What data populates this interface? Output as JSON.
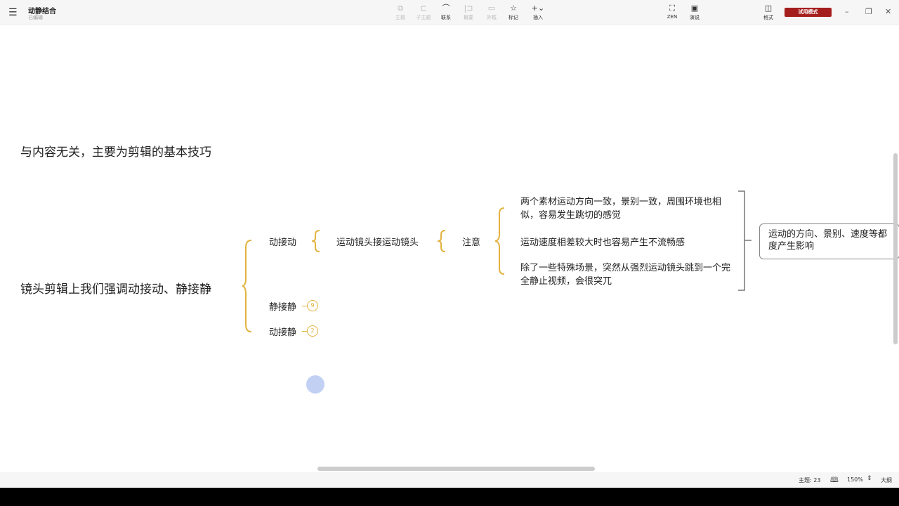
{
  "app": {
    "title": "动静结合",
    "status": "已编辑"
  },
  "toolbar": [
    {
      "label": "主题",
      "icon": "topic-icon",
      "enabled": false
    },
    {
      "label": "子主题",
      "icon": "subtopic-icon",
      "enabled": false
    },
    {
      "label": "联系",
      "icon": "relationship-icon",
      "enabled": true
    },
    {
      "label": "概要",
      "icon": "summary-icon",
      "enabled": false
    },
    {
      "label": "外框",
      "icon": "boundary-icon",
      "enabled": false
    },
    {
      "label": "标记",
      "icon": "star-icon",
      "enabled": true
    },
    {
      "label": "插入",
      "icon": "plus-icon",
      "enabled": true
    }
  ],
  "right_toolbar": {
    "zen": "ZEN",
    "present": "演说",
    "format": "格式",
    "trial": "试用模式"
  },
  "map": {
    "note": "与内容无关，主要为剪辑的基本技巧",
    "root": "镜头剪辑上我们强调动接动、静接静",
    "branch1": "动接动",
    "branch1_child": "运动镜头接运动镜头",
    "attention": "注意",
    "points": [
      "两个素材运动方向一致，景别一致，周围环境也相似，容易发生跳切的感觉",
      "运动速度相差较大时也容易产生不流畅感",
      "除了一些特殊场景，突然从强烈运动镜头跳到一个完全静止视频，会很突兀"
    ],
    "summary": "运动的方向、景别、速度等都度产生影响",
    "branch2": "静接静",
    "branch2_count": "9",
    "branch3": "动接静",
    "branch3_count": "2"
  },
  "statusbar": {
    "topics": "主题: 23",
    "zoom": "150%",
    "outline": "大纲"
  },
  "colors": {
    "brace": "#e3b341",
    "trial": "#a51e1e"
  }
}
